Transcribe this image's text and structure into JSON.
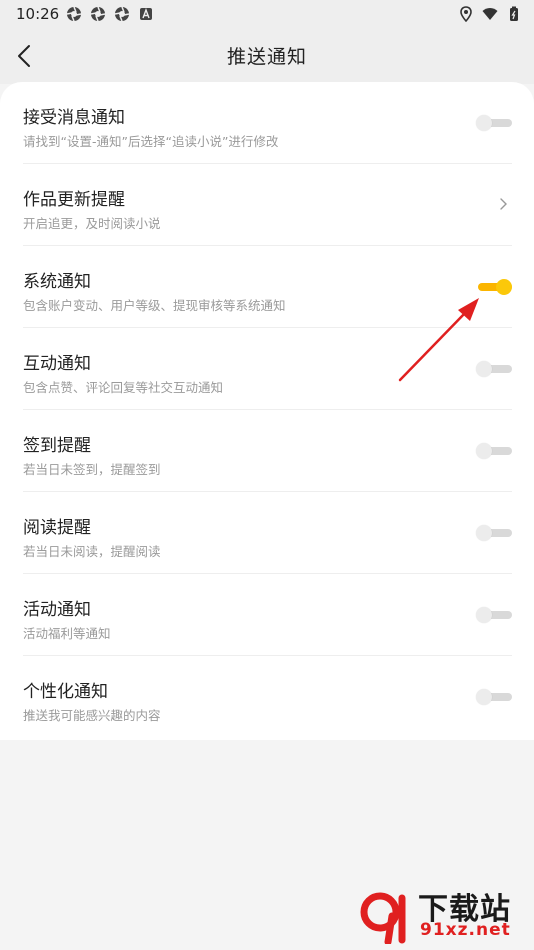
{
  "status_bar": {
    "time": "10:26",
    "left_icons": [
      "aperture-icon",
      "aperture-icon",
      "aperture-icon",
      "a-badge-icon"
    ],
    "right_icons": [
      "location-icon",
      "wifi-icon",
      "battery-icon"
    ]
  },
  "header": {
    "title": "推送通知",
    "back_icon": "chevron-left-icon"
  },
  "settings": [
    {
      "title": "接受消息通知",
      "subtitle": "请找到“设置-通知”后选择“追读小说”进行修改",
      "control": "toggle",
      "on": false
    },
    {
      "title": "作品更新提醒",
      "subtitle": "开启追更，及时阅读小说",
      "control": "chevron",
      "on": false
    },
    {
      "title": "系统通知",
      "subtitle": "包含账户变动、用户等级、提现审核等系统通知",
      "control": "toggle",
      "on": true
    },
    {
      "title": "互动通知",
      "subtitle": "包含点赞、评论回复等社交互动通知",
      "control": "toggle",
      "on": false
    },
    {
      "title": "签到提醒",
      "subtitle": "若当日未签到，提醒签到",
      "control": "toggle",
      "on": false
    },
    {
      "title": "阅读提醒",
      "subtitle": "若当日未阅读，提醒阅读",
      "control": "toggle",
      "on": false
    },
    {
      "title": "活动通知",
      "subtitle": "活动福利等通知",
      "control": "toggle",
      "on": false
    },
    {
      "title": "个性化通知",
      "subtitle": "推送我可能感兴趣的内容",
      "control": "toggle",
      "on": false
    }
  ],
  "colors": {
    "accent": "#fbc80a",
    "annotation_arrow": "#e02020",
    "background": "#f4f4f4"
  },
  "watermark": {
    "title": "下载站",
    "url": "91xz.net"
  }
}
